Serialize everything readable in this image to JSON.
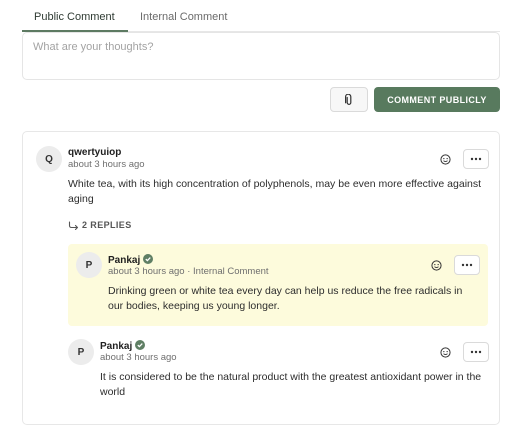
{
  "tabs": [
    {
      "label": "Public Comment",
      "active": true
    },
    {
      "label": "Internal Comment",
      "active": false
    }
  ],
  "composer": {
    "placeholder": "What are your thoughts?",
    "value": "",
    "publish_label": "COMMENT PUBLICLY",
    "attach_icon": "paperclip-icon"
  },
  "colors": {
    "accent": "#587a5e",
    "internal_bg": "#fdfbdc",
    "verified": "#5f7f64"
  },
  "comment": {
    "avatar": "Q",
    "author": "qwertyuiop",
    "time": "about 3 hours ago",
    "text": "White tea, with its high concentration of polyphenols, may be even more effective against aging",
    "replies_label": "2 REPLIES",
    "replies": [
      {
        "avatar": "P",
        "author": "Pankaj",
        "verified": true,
        "meta": "about 3 hours ago · Internal Comment",
        "internal": true,
        "text": "Drinking green or white tea every day can help us reduce the free radicals in our bodies, keeping us young longer."
      },
      {
        "avatar": "P",
        "author": "Pankaj",
        "verified": true,
        "meta": "about 3 hours ago",
        "internal": false,
        "text": "It is considered to be the natural product with the greatest antioxidant power in the world"
      }
    ]
  }
}
